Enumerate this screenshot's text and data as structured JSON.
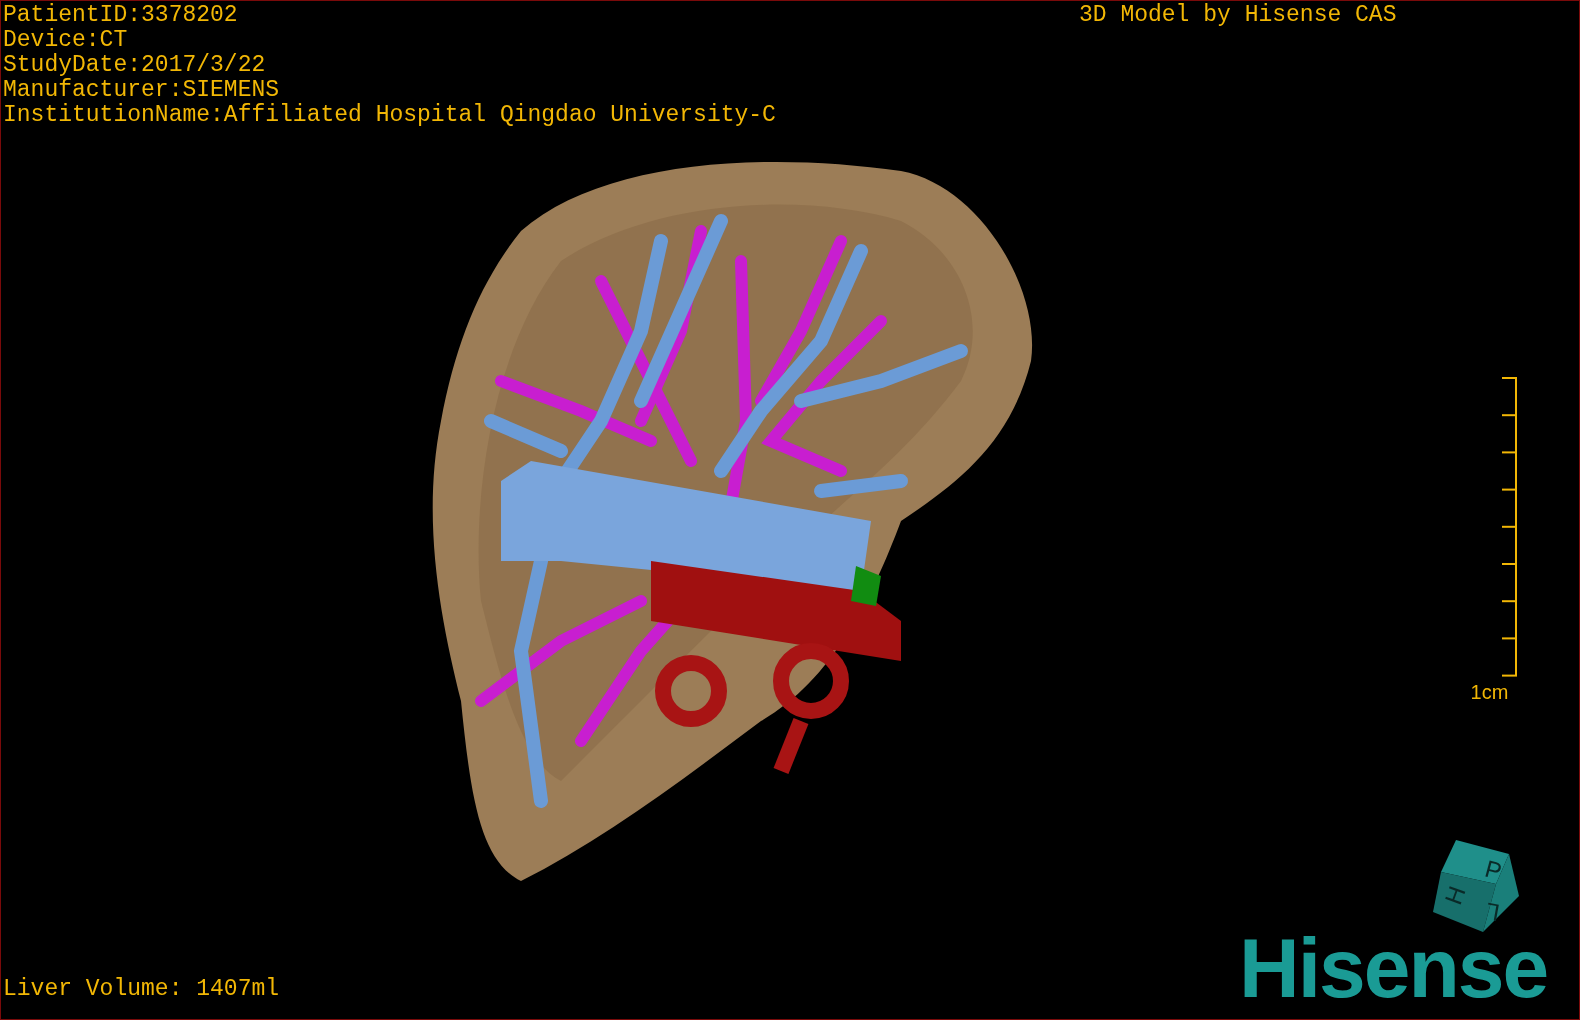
{
  "patient_info": [
    "PatientID:3378202",
    "Device:CT",
    "StudyDate:2017/3/22",
    "Manufacturer:SIEMENS",
    "InstitutionName:Affiliated Hospital Qingdao University-C"
  ],
  "credit": "3D Model by Hisense CAS",
  "scale_bar": {
    "label": "1cm"
  },
  "orientation_cube": {
    "faces": [
      "H",
      "P",
      "L"
    ]
  },
  "logo": "Hisense",
  "liver_volume": "Liver Volume: 1407ml"
}
